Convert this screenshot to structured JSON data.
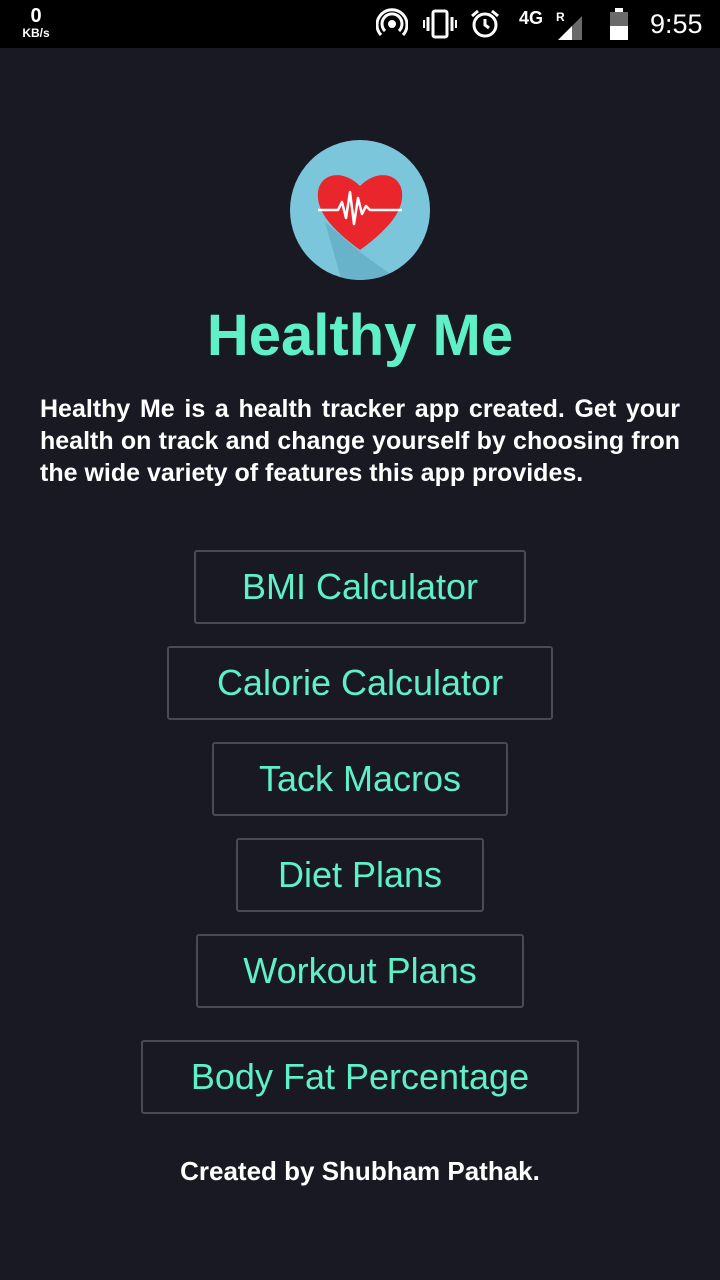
{
  "status_bar": {
    "net_speed_value": "0",
    "net_speed_unit": "KB/s",
    "network_type": "4G",
    "roaming": "R",
    "time": "9:55",
    "icons": [
      "hotspot-icon",
      "vibrate-icon",
      "alarm-icon",
      "signal-icon",
      "battery-icon"
    ]
  },
  "app": {
    "logo_icon": "heart-pulse-icon",
    "title": "Healthy Me",
    "description": "Healthy Me is a health tracker app created. Get your health on track and change yourself by choosing fron the wide variety of features this app provides."
  },
  "menu": {
    "bmi": "BMI Calculator",
    "calorie": "Calorie Calculator",
    "macros": "Tack Macros",
    "diet": "Diet Plans",
    "workout": "Workout Plans",
    "body_fat": "Body Fat Percentage"
  },
  "footer": "Created by Shubham Pathak.",
  "colors": {
    "background": "#191924",
    "accent": "#5ff0c8",
    "logo_circle": "#7cc6dc",
    "heart": "#e8262c"
  }
}
